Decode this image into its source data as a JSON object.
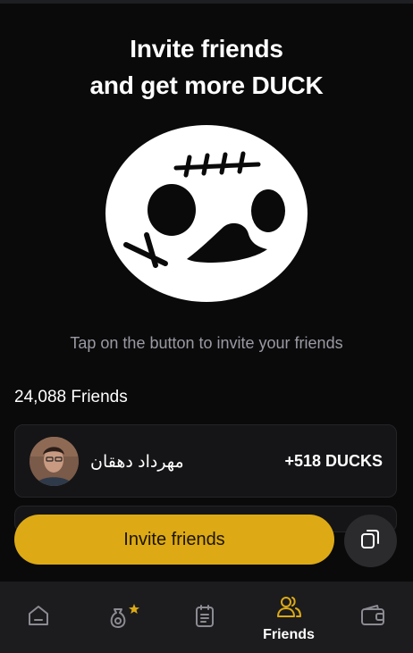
{
  "header": {
    "title_line1": "Invite friends",
    "title_line2": "and get more DUCK"
  },
  "mascot": {
    "icon": "duck-face-mascot"
  },
  "subtitle": "Tap on the button to invite your friends",
  "friends": {
    "count_label": "24,088 Friends",
    "list": [
      {
        "name": "مهرداد دهقان",
        "reward": "+518 DUCKS"
      }
    ]
  },
  "actions": {
    "invite_label": "Invite friends",
    "copy_icon": "copy-icon"
  },
  "tabbar": {
    "tabs": [
      {
        "icon": "home-icon",
        "label": ""
      },
      {
        "icon": "money-bag-star-icon",
        "label": ""
      },
      {
        "icon": "tasks-icon",
        "label": ""
      },
      {
        "icon": "friends-icon",
        "label": "Friends",
        "active": true
      },
      {
        "icon": "wallet-icon",
        "label": ""
      }
    ]
  },
  "colors": {
    "background": "#0a0a0b",
    "accent": "#ddaa16",
    "card": "#151517",
    "tabbar": "#1c1c1e",
    "muted_text": "#9a9aa3"
  }
}
